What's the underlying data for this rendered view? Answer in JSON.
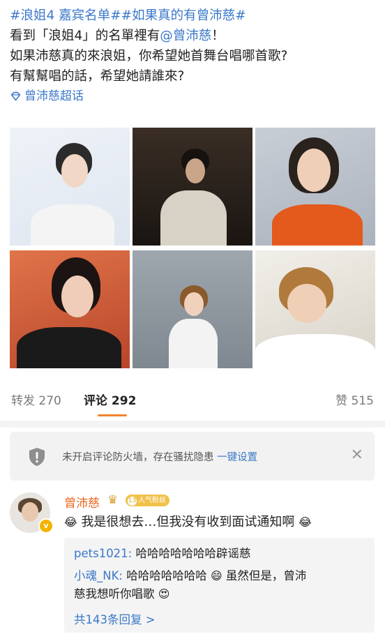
{
  "post": {
    "line1": "#浪姐4 嘉宾名单##如果真的有曾沛慈#",
    "line2_pre": "看到「浪姐4」的名單裡有",
    "line2_mention": "@曾沛慈",
    "line2_post": "！",
    "line3": "如果沛慈真的來浪姐，你希望她首舞台唱哪首歌?",
    "line4": "有幫幫唱的話，希望她請誰來?",
    "super_topic": "曾沛慈超话"
  },
  "stats": {
    "repost": "转发 270",
    "comment": "评论 292",
    "like": "赞 515"
  },
  "firewall": {
    "text": "未开启评论防火墙，存在骚扰隐患",
    "link": "一键设置"
  },
  "comment": {
    "username": "曾沛慈",
    "level": "13",
    "fan_badge": "人气粉丝",
    "text": "我是很想去…但我没有收到面试通知啊",
    "replies": [
      {
        "user": "pets1021:",
        "text": "哈哈哈哈哈哈哈辟谣慈"
      },
      {
        "user": "小魂_NK:",
        "text": "哈哈哈哈哈哈哈",
        "text2": "虽然但是，曾沛",
        "text3": "慈我想听你唱歌"
      }
    ],
    "more": "共143条回复 >"
  },
  "colors": {
    "link": "#3a78c9",
    "accent": "#f5822a",
    "username": "#e8651a"
  }
}
